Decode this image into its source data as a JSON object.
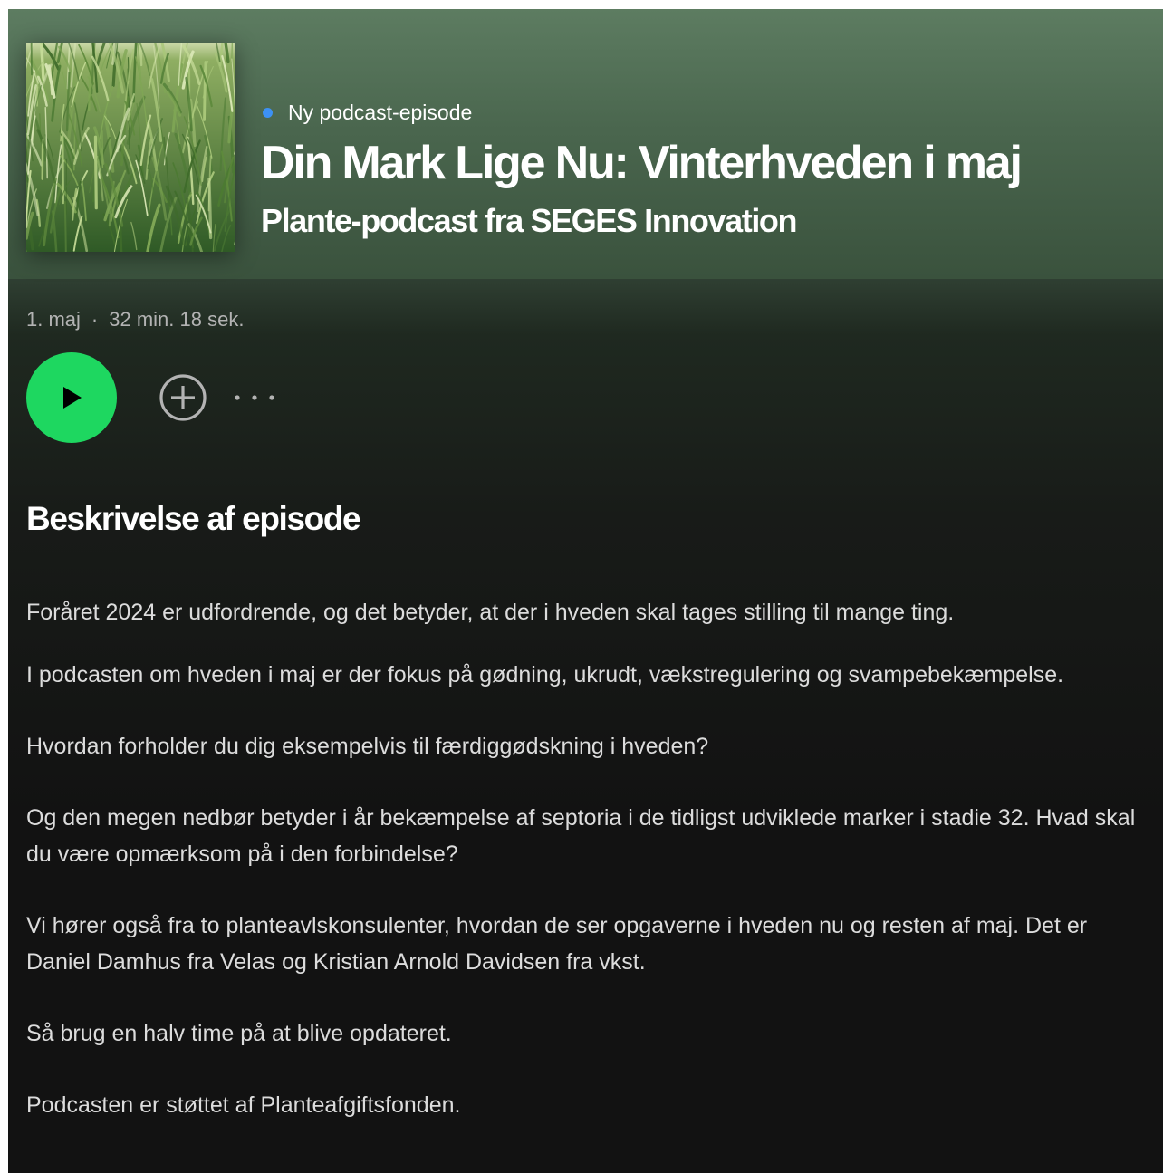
{
  "header": {
    "badge_label": "Ny podcast-episode",
    "episode_title": "Din Mark Lige Nu: Vinterhveden i maj",
    "show_title": "Plante-podcast fra SEGES Innovation"
  },
  "meta": {
    "date": "1. maj",
    "separator": "·",
    "duration": "32 min. 18 sek."
  },
  "controls": {
    "play_icon": "play-icon",
    "add_icon": "plus-circle-icon",
    "more_icon": "more-dots-icon"
  },
  "description": {
    "heading": "Beskrivelse af episode",
    "paragraphs": [
      "Foråret 2024 er udfordrende, og det betyder, at der i hveden skal tages stilling til mange ting.",
      "I podcasten om hveden i maj er der fokus på gødning, ukrudt, vækstregulering og svampebekæmpelse.",
      "Hvordan forholder du dig eksempelvis til færdiggødskning i hveden?",
      "Og den megen nedbør betyder i år bekæmpelse af septoria i de tidligst udviklede marker i stadie 32. Hvad skal du være opmærksom på i den forbindelse?",
      "Vi hører også fra to planteavlskonsulenter, hvordan de ser opgaverne i hveden nu og resten af maj.  Det er Daniel Damhus fra Velas og Kristian Arnold Davidsen fra vkst.",
      "Så brug en halv time på at blive opdateret.",
      "Podcasten er støttet af Planteafgiftsfonden."
    ]
  },
  "colors": {
    "accent_green": "#1ed760",
    "badge_blue": "#3d91f4",
    "header_green": "#5d7c61",
    "background": "#121212"
  }
}
